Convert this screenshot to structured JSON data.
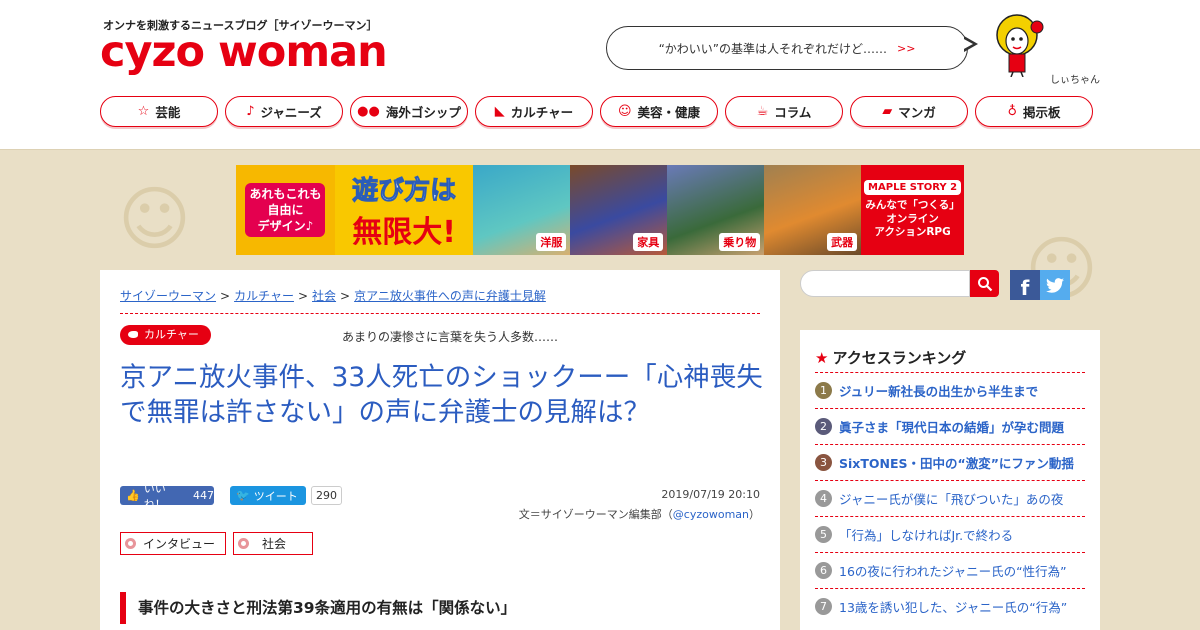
{
  "header": {
    "tagline": "オンナを刺激するニュースブログ［サイゾーウーマン］",
    "logo": "cyzo woman",
    "bubble_text": "“かわいい”の基準は人それぞれだけど……",
    "bubble_more": ">>",
    "mascot_name": "しぃちゃん"
  },
  "nav": [
    {
      "label": "芸能",
      "icon": "star-icon"
    },
    {
      "label": "ジャニーズ",
      "icon": "mic-icon"
    },
    {
      "label": "海外ゴシップ",
      "icon": "sunglasses-icon"
    },
    {
      "label": "カルチャー",
      "icon": "shoe-icon"
    },
    {
      "label": "美容・健康",
      "icon": "face-mask-icon"
    },
    {
      "label": "コラム",
      "icon": "teacup-icon"
    },
    {
      "label": "マンガ",
      "icon": "book-icon"
    },
    {
      "label": "掲示板",
      "icon": "pin-icon"
    }
  ],
  "banner": {
    "left_text": "あれもこれも\n自由に\nデザイン♪",
    "title_1": "遊び方は",
    "title_2": "無限大!",
    "panels": [
      "洋服",
      "家具",
      "乗り物",
      "武器"
    ],
    "brand": "MAPLE STORY 2",
    "right_text": "みんなで「つくる」\nオンライン\nアクションRPG"
  },
  "article": {
    "breadcrumbs": [
      "サイゾーウーマン",
      "カルチャー",
      "社会",
      "京アニ放火事件への声に弁護士見解"
    ],
    "breadcrumb_sep": ">",
    "category": "カルチャー",
    "subtitle": "あまりの凄惨さに言葉を失う人多数……",
    "title": "京アニ放火事件、33人死亡のショックーー「心神喪失で無罪は許さない」の声に弁護士の見解は？",
    "like_label": "いいね！",
    "like_count": "447",
    "tweet_label": "ツイート",
    "tweet_count": "290",
    "date": "2019/07/19 20:10",
    "author_prefix": "文＝サイゾーウーマン編集部（",
    "author_handle": "@cyzowoman",
    "author_suffix": "）",
    "tags": [
      "インタビュー",
      "社会"
    ],
    "section_heading": "事件の大きさと刑法第39条適用の有無は「関係ない」"
  },
  "sidebar": {
    "search_placeholder": "",
    "facebook": "f",
    "ranking_title": "アクセスランキング",
    "ranking": [
      {
        "rank": "1",
        "text": "ジュリー新社長の出生から半生まで",
        "color": "#8c7a4a"
      },
      {
        "rank": "2",
        "text": "眞子さま「現代日本の結婚」が孕む問題",
        "color": "#5b5b7a"
      },
      {
        "rank": "3",
        "text": "SixTONES・田中の“激変”にファン動揺",
        "color": "#8a5540"
      },
      {
        "rank": "4",
        "text": "ジャニー氏が僕に「飛びついた」あの夜",
        "color": "#999999"
      },
      {
        "rank": "5",
        "text": "「行為」しなければJr.で終わる",
        "color": "#999999"
      },
      {
        "rank": "6",
        "text": "16の夜に行われたジャニー氏の“性行為”",
        "color": "#999999"
      },
      {
        "rank": "7",
        "text": "13歳を誘い犯した、ジャニー氏の“行為”",
        "color": "#999999"
      }
    ]
  },
  "colors": {
    "accent": "#e60012",
    "link": "#2b64c8",
    "background": "#e9dfc6"
  }
}
